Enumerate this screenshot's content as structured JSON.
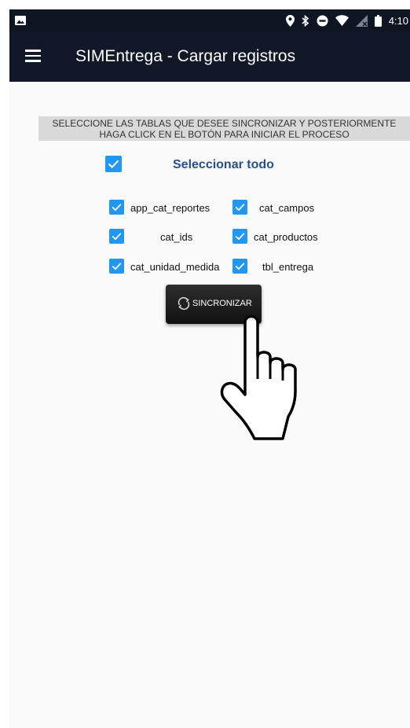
{
  "status_bar": {
    "time": "4:10"
  },
  "app_bar": {
    "title": "SIMEntrega - Cargar registros"
  },
  "instructions": {
    "line1": "SELECCIONE LAS TABLAS QUE DESEE SINCRONIZAR Y POSTERIORMENTE",
    "line2": "HAGA CLICK EN EL BOTÓN PARA INICIAR EL PROCESO"
  },
  "select_all": {
    "label": "Seleccionar todo",
    "checked": true
  },
  "tables": [
    {
      "label": "app_cat_reportes",
      "checked": true
    },
    {
      "label": "cat_campos",
      "checked": true
    },
    {
      "label": "cat_ids",
      "checked": true
    },
    {
      "label": "cat_productos",
      "checked": true
    },
    {
      "label": "cat_unidad_medida",
      "checked": true
    },
    {
      "label": "tbl_entrega",
      "checked": true
    }
  ],
  "sync_button": {
    "label": "SINCRONIZAR",
    "icon": "sync-icon"
  },
  "colors": {
    "status_bar": "#0e1624",
    "app_bar": "#111827",
    "checkbox": "#2196f3",
    "select_all_text": "#2a4f8a",
    "instructions_bg": "#d9d9d9",
    "background": "#fafafa"
  }
}
